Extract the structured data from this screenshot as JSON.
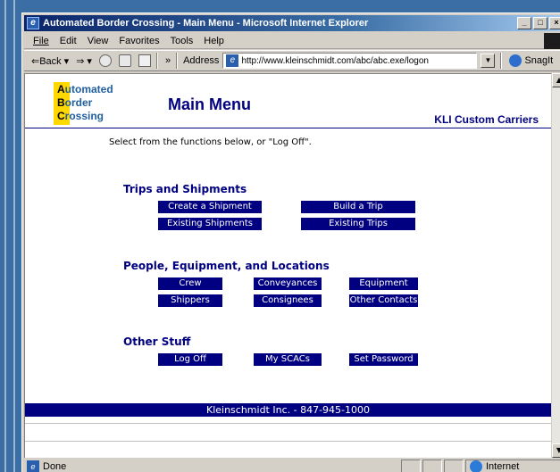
{
  "window": {
    "title": "Automated Border Crossing - Main Menu - Microsoft Internet Explorer",
    "min_glyph": "_",
    "restore_glyph": "□",
    "close_glyph": "×"
  },
  "menubar": {
    "items": [
      "File",
      "Edit",
      "View",
      "Favorites",
      "Tools",
      "Help"
    ]
  },
  "toolbar": {
    "back": "⇐Back",
    "back_drop": "▾",
    "forward": "⇒",
    "forward_drop": "▾",
    "more": "»",
    "address_label": "Address",
    "address_value": "http://www.kleinschmidt.com/abc/abc.exe/logon",
    "snagit": "SnagIt"
  },
  "logo": {
    "line1_first": "A",
    "line1_rest": "utomated",
    "line2_first": "B",
    "line2_rest": "order",
    "line3_first": "C",
    "line3_rest": "rossing"
  },
  "page": {
    "title": "Main Menu",
    "company": "KLI Custom Carriers",
    "intro": "Select from the functions below, or \"Log Off\"."
  },
  "sections": {
    "trips": {
      "heading": "Trips and Shipments",
      "create_shipment": "Create a Shipment",
      "build_trip": "Build a Trip",
      "existing_shipments": "Existing Shipments",
      "existing_trips": "Existing Trips"
    },
    "people": {
      "heading": "People, Equipment, and Locations",
      "crew": "Crew",
      "conveyances": "Conveyances",
      "equipment": "Equipment",
      "shippers": "Shippers",
      "consignees": "Consignees",
      "other_contacts": "Other Contacts"
    },
    "other": {
      "heading": "Other Stuff",
      "log_off": "Log Off",
      "my_scacs": "My SCACs",
      "set_password": "Set Password"
    }
  },
  "footer": {
    "text": "Kleinschmidt Inc. - 847-945-1000"
  },
  "statusbar": {
    "status": "Done",
    "zone": "Internet"
  },
  "colors": {
    "navy": "#000080",
    "logo_yellow": "#ffd800",
    "titlebar": "#0a246a"
  }
}
